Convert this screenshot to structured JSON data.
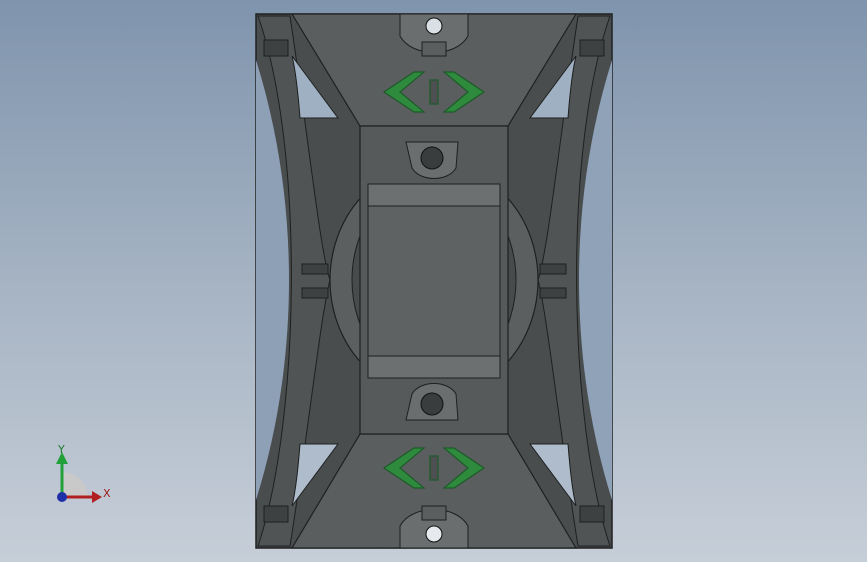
{
  "viewport": {
    "background_top": "#7f94ad",
    "background_bottom": "#c6ced8"
  },
  "model": {
    "body_color": "#4f5252",
    "body_dark": "#3a3d3e",
    "face_light": "#6a6e6f",
    "logo_color": "#2e8b3e",
    "logo_outline": "#1d5a28"
  },
  "triad": {
    "x_label": "X",
    "y_label": "Y",
    "x_color": "#b02020",
    "y_color": "#22a03a",
    "z_color": "#1f2fa8",
    "icon": "coordinate-triad-icon"
  }
}
